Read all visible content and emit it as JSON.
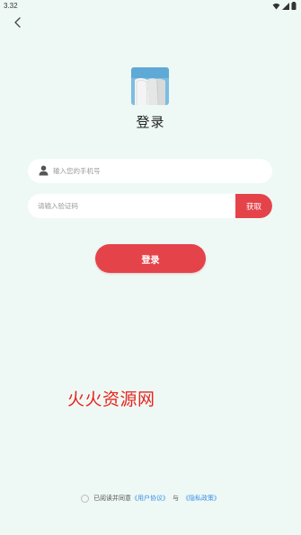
{
  "status_bar": {
    "time": "3.32",
    "icons": [
      "wifi-icon",
      "signal-icon",
      "battery-icon"
    ]
  },
  "header": {
    "back_icon": "chevron-left-icon"
  },
  "logo": {
    "icon": "open-book-logo",
    "colors": {
      "sky": "#6fb3dc",
      "page": "#f2f2f2"
    }
  },
  "title": "登录",
  "phone_field": {
    "icon": "user-icon",
    "placeholder": "输入您的手机号",
    "value": ""
  },
  "code_field": {
    "placeholder": "请输入验证码",
    "value": "",
    "get_code_label": "获取"
  },
  "login_button_label": "登录",
  "watermark": "火火资源网",
  "agreement": {
    "prefix": "已阅读并同意",
    "user_agreement": "《用户协议》",
    "connector": "与",
    "privacy_policy": "《隐私政策》",
    "checked": false
  },
  "colors": {
    "background": "#eef9f5",
    "accent": "#e4434a",
    "link": "#3a8ee6",
    "watermark": "#e8231d"
  }
}
